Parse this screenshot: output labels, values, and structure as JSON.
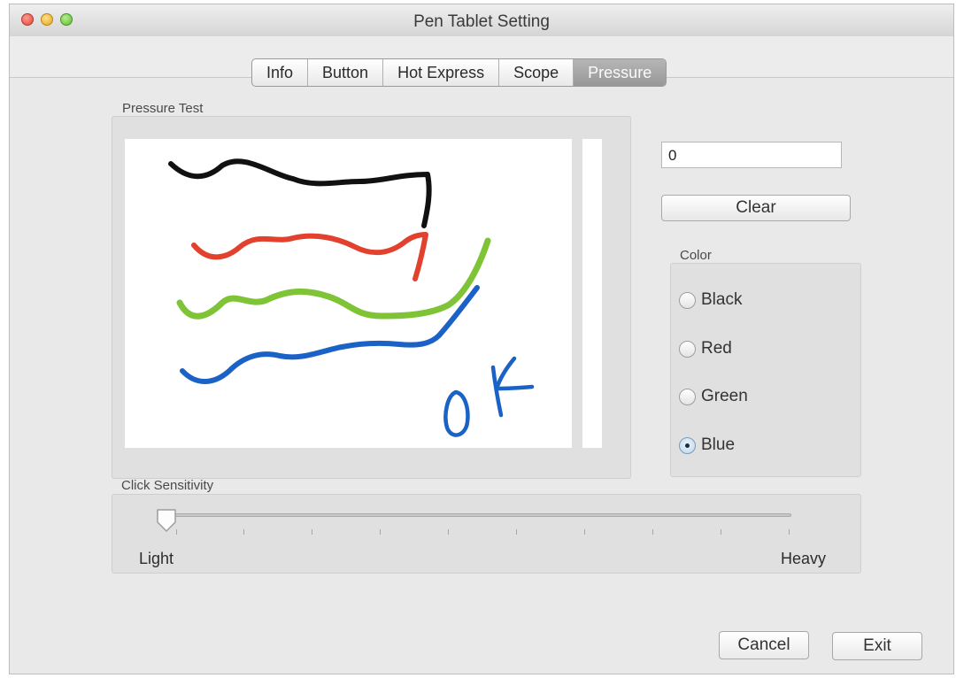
{
  "window": {
    "title": "Pen Tablet Setting"
  },
  "tabs": [
    {
      "label": "Info",
      "active": false
    },
    {
      "label": "Button",
      "active": false
    },
    {
      "label": "Hot Express",
      "active": false
    },
    {
      "label": "Scope",
      "active": false
    },
    {
      "label": "Pressure",
      "active": true
    }
  ],
  "pressure_test": {
    "label": "Pressure Test",
    "value": "0",
    "clear_label": "Clear",
    "drawing_text": "oK",
    "stroke_colors": {
      "black": "#111111",
      "red": "#e2412d",
      "green": "#7ec436",
      "blue": "#1b62c6"
    }
  },
  "color": {
    "label": "Color",
    "options": [
      "Black",
      "Red",
      "Green",
      "Blue"
    ],
    "selected": "Blue"
  },
  "click_sensitivity": {
    "label": "Click Sensitivity",
    "min_label": "Light",
    "max_label": "Heavy",
    "value": 0
  },
  "footer": {
    "cancel_label": "Cancel",
    "exit_label": "Exit"
  }
}
